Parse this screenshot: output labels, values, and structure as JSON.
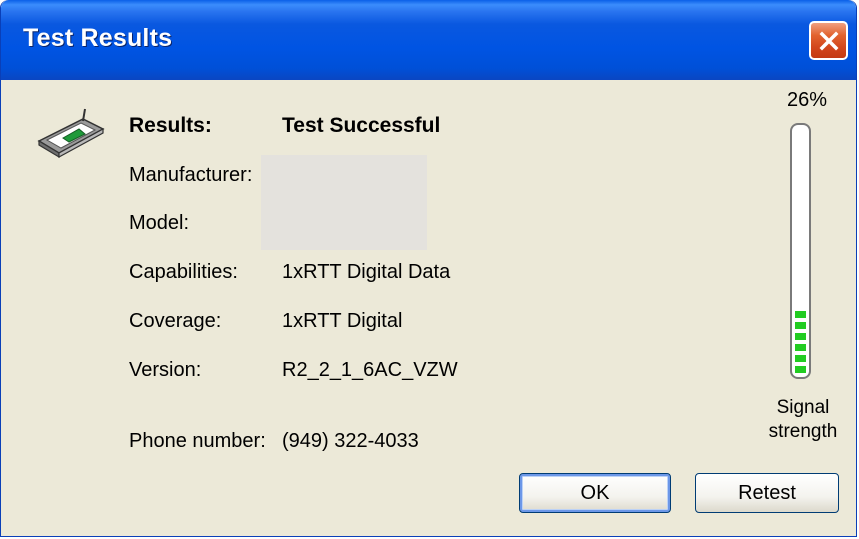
{
  "window": {
    "title": "Test Results",
    "close_icon": "close-icon",
    "close_color": "#d2461c"
  },
  "device_icon": "modem-icon",
  "results": {
    "results_label": "Results:",
    "results_value": "Test Successful",
    "manufacturer_label": "Manufacturer:",
    "manufacturer_value": "",
    "model_label": "Model:",
    "model_value": "",
    "capabilities_label": "Capabilities:",
    "capabilities_value": "1xRTT Digital Data",
    "coverage_label": "Coverage:",
    "coverage_value": "1xRTT Digital",
    "version_label": "Version:",
    "version_value": "R2_2_1_6AC_VZW",
    "phone_label": "Phone number:",
    "phone_value": "(949) 322-4033"
  },
  "signal": {
    "percent_text": "26%",
    "level": 0.26,
    "label_line1": "Signal",
    "label_line2": "strength",
    "bar_color": "#22cc22"
  },
  "buttons": {
    "ok_label": "OK",
    "retest_label": "Retest"
  }
}
